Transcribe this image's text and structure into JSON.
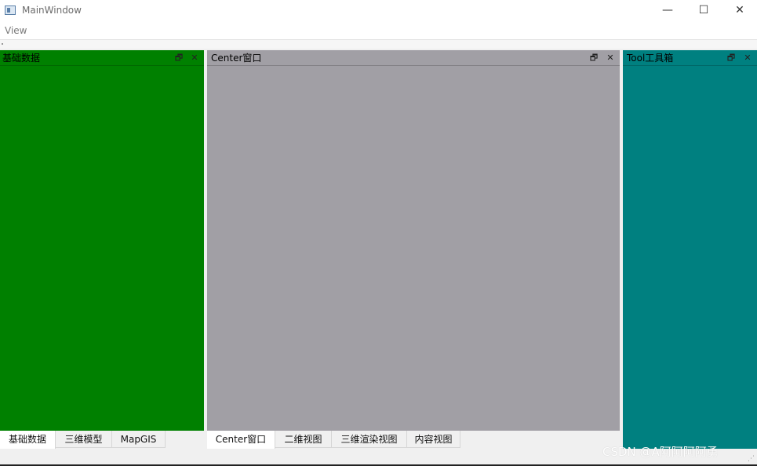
{
  "window": {
    "title": "MainWindow",
    "minimize_glyph": "—",
    "maximize_glyph": "☐",
    "close_glyph": "✕"
  },
  "menu": {
    "items": [
      "View"
    ]
  },
  "docks": {
    "left": {
      "title": "基础数据",
      "color": "#008000",
      "float_glyph": "🗗",
      "close_glyph": "✕"
    },
    "center": {
      "title": "Center窗口",
      "color": "#a19fa5",
      "float_glyph": "🗗",
      "close_glyph": "✕"
    },
    "right": {
      "title": "Tool工具箱",
      "color": "#008080",
      "float_glyph": "🗗",
      "close_glyph": "✕"
    }
  },
  "left_tabs": [
    "基础数据",
    "三维模型",
    "MapGIS"
  ],
  "center_tabs": [
    "Center窗口",
    "二维视图",
    "三维渲染视图",
    "内容视图"
  ],
  "watermark": "CSDN @A阿阿阿阿勇"
}
